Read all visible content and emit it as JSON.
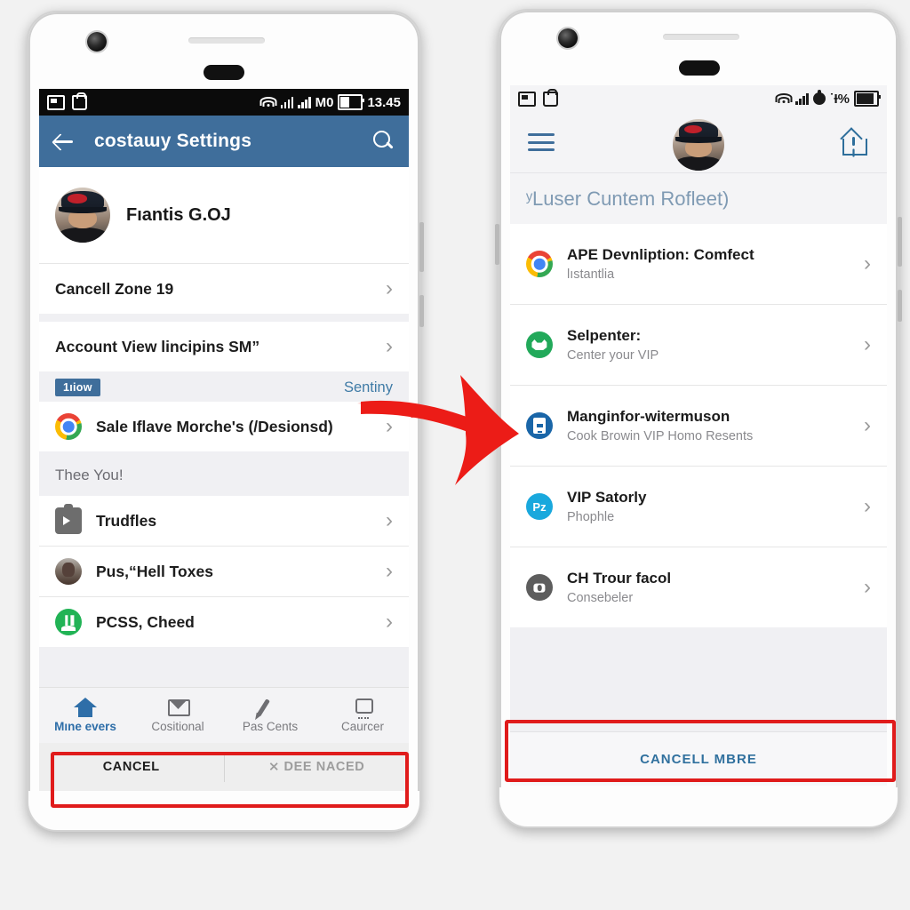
{
  "left_phone": {
    "status_bar": {
      "time": "13.45",
      "carrier": "M0",
      "icons": [
        "screenshot-icon",
        "bag-icon",
        "wifi-icon",
        "signal-icon",
        "signal2-icon",
        "battery-icon"
      ]
    },
    "app_bar": {
      "title": "costaɯy Settings",
      "back_icon": "back-arrow-icon",
      "search_icon": "search-icon"
    },
    "profile": {
      "name": "Fıantis G.OJ",
      "avatar": "user-avatar"
    },
    "rows": [
      {
        "label": "Cancell Zone 19",
        "chevron": "›"
      },
      {
        "label": "Account View lincipins SM”",
        "chevron": "›"
      }
    ],
    "badge_row": {
      "badge": "1ıiow",
      "link": "Sentiny"
    },
    "chrome_row": {
      "label": "Sale Iflave Morche's (/Desionsd)",
      "icon": "chrome-icon",
      "chevron": "›"
    },
    "section_header": "Thee You!",
    "list": [
      {
        "label": "Trudfles",
        "icon": "media-icon",
        "chevron": "›"
      },
      {
        "label": "Pus,“Hell Toxes",
        "icon": "person-avatar-icon",
        "chevron": "›"
      },
      {
        "label": "PCSS, Cheed",
        "icon": "green-app-icon",
        "chevron": "›"
      }
    ],
    "bottom_nav": [
      {
        "label": "Mıne evers",
        "icon": "home-icon",
        "active": true
      },
      {
        "label": "Cositional",
        "icon": "mail-icon",
        "active": false
      },
      {
        "label": "Pas Cents",
        "icon": "pen-icon",
        "active": false
      },
      {
        "label": "Caurcer",
        "icon": "customer-icon",
        "active": false
      }
    ],
    "action_bar": {
      "cancel": "CANCEL",
      "confirm": "⨯ DEE NACED"
    }
  },
  "right_phone": {
    "status_bar": {
      "battery_text": "˙Ɨ%",
      "icons": [
        "muted-icon",
        "clipboard-icon",
        "wifi-icon",
        "signal-icon",
        "alarm-icon",
        "battery-icon"
      ]
    },
    "top_bar": {
      "menu_icon": "hamburger-menu-icon",
      "avatar": "user-avatar",
      "share_icon": "report-home-icon"
    },
    "section_header": "ʸLuser Cuntem Rofleet)",
    "list": [
      {
        "title": "APE Devnliption: Comfect",
        "subtitle": "lıstantlia",
        "icon": "chrome-icon",
        "chevron": "›"
      },
      {
        "title": "Selpenter:",
        "subtitle": "Center your VIP",
        "icon": "green-team-icon",
        "chevron": "›"
      },
      {
        "title": "Manginfor-witermuson",
        "subtitle": "Cook Browin VIP Homo Resents",
        "icon": "calendar-icon",
        "chevron": "›"
      },
      {
        "title": "VIP Satorly",
        "subtitle": "Phophle",
        "icon": "pz-icon",
        "icon_text": "Pz",
        "chevron": "›"
      },
      {
        "title": "CH Trour facol",
        "subtitle": "Consebeler",
        "icon": "camera-icon",
        "chevron": "›"
      }
    ],
    "bottom_button": "CANCELL MBRE"
  },
  "annotations": {
    "arrow": "red-arrow-right",
    "highlight_color": "#e01b1b"
  },
  "colors": {
    "appbar_blue": "#3f6e9b",
    "link_blue": "#3f7ba6",
    "accent_red": "#e01b1b",
    "screen_bg": "#f0f0f3"
  }
}
